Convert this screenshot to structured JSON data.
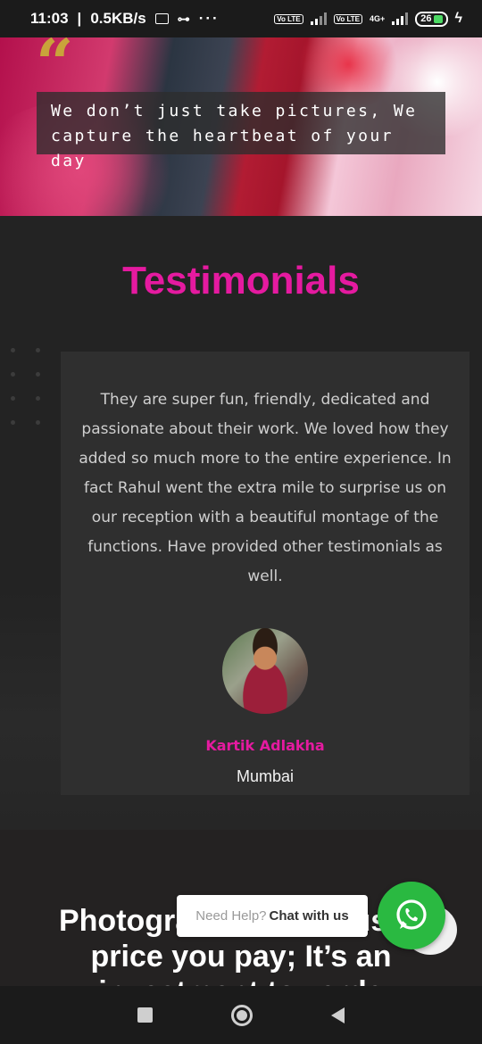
{
  "status_bar": {
    "time": "11:03",
    "network_speed": "0.5KB/s",
    "volte_label": "Vo LTE",
    "network_type": "4G+",
    "battery": "26"
  },
  "hero": {
    "caption": "We don’t just take pictures, We capture the heartbeat of your day"
  },
  "testimonials": {
    "title": "Testimonials",
    "quote": "They are super fun, friendly, dedicated and passionate about their work. We loved how they added so much more to the entire experience. In fact Rahul went the extra mile to surprise us on our reception with a beautiful montage of the functions. Have provided other testimonials as well.",
    "author_name": "Kartik Adlakha",
    "author_city": "Mumbai"
  },
  "lower_section": {
    "heading": "Photography is not just a price you pay; It’s an investment towards"
  },
  "chat_widget": {
    "prompt": "Need Help?",
    "cta": "Chat with us"
  },
  "colors": {
    "accent": "#e51aa0",
    "whatsapp": "#2ab941",
    "background": "#232323",
    "card": "#2f2f2f"
  },
  "icons": {
    "nav": [
      "recents-square-icon",
      "home-circle-icon",
      "back-triangle-icon"
    ],
    "chat": "whatsapp-icon"
  }
}
